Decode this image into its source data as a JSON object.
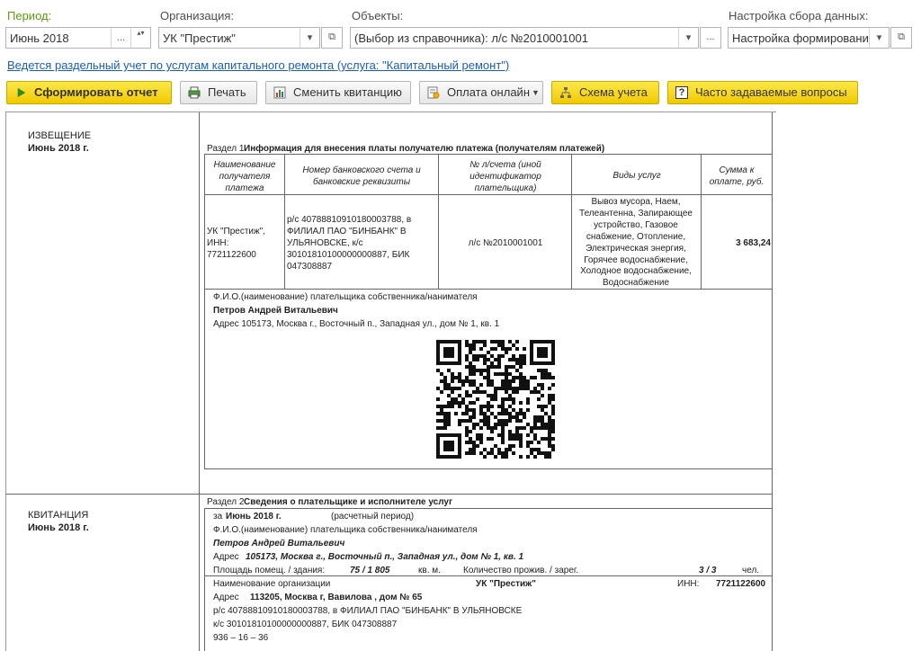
{
  "filters": {
    "period_label": "Период:",
    "period_value": "Июнь 2018",
    "org_label": "Организация:",
    "org_value": "УК \"Престиж\"",
    "objects_label": "Объекты:",
    "objects_value": "(Выбор из справочника): л/с №2010001001",
    "settings_label": "Настройка сбора данных:",
    "settings_value": "Настройка формирования",
    "ellipsis": "...",
    "dropdown": "▾",
    "open": "⧉",
    "spin": "▴▾"
  },
  "link_text": "Ведется раздельный учет по услугам капитального ремонта (услуга: \"Капитальный ремонт\")",
  "toolbar": {
    "generate": "Сформировать отчет",
    "print": "Печать",
    "change_receipt": "Сменить квитанцию",
    "pay_online": "Оплата онлайн",
    "scheme": "Схема учета",
    "faq": "Часто задаваемые вопросы"
  },
  "notice": {
    "title": "ИЗВЕЩЕНИЕ",
    "period": "Июнь 2018 г.",
    "section_no": "Раздел 1",
    "section_title": "Информация для внесения платы получателю платежа (получателям платежей)",
    "headers": {
      "recipient": "Наименование получателя платежа",
      "account": "Номер банковского счета и банковские реквизиты",
      "payer_id": "№ л/счета (иной идентификатор плательщика)",
      "services": "Виды услуг",
      "amount": "Сумма к оплате, руб."
    },
    "row": {
      "recipient": "УК \"Престиж\", ИНН: 7721122600",
      "account": "р/с 40788810910180003788, в ФИЛИАЛ ПАО \"БИНБАНК\" В УЛЬЯНОВСКЕ, к/с 30101810100000000887, БИК 047308887",
      "payer_id": "л/с №2010001001",
      "services": "Вывоз мусора, Наем, Телеантенна, Запирающее устройство, Газовое снабжение, Отопление, Электрическая энергия, Горячее водоснабжение, Холодное водоснабжение, Водоснабжение",
      "amount": "3 683,24"
    },
    "payer_label": "Ф.И.О.(наименование) плательщика собственника/нанимателя",
    "payer_name": "Петров Андрей Витальевич",
    "address": "Адрес 105173, Москва г., Восточный п., Западная ул., дом № 1, кв. 1"
  },
  "receipt": {
    "title": "КВИТАНЦИЯ",
    "period": "Июнь 2018 г.",
    "section_no": "Раздел 2",
    "section_title": "Сведения о плательщике и исполнителе услуг",
    "for_label": "за",
    "for_period": "Июнь 2018 г.",
    "period_caption": "(расчетный период)",
    "payer_label": "Ф.И.О.(наименование) плательщика собственника/нанимателя",
    "payer_name": "Петров Андрей Витальевич",
    "address_label": "Адрес",
    "address_value": "105173, Москва г., Восточный п., Западная ул., дом № 1, кв. 1",
    "area_label": "Площадь помещ. / здания:",
    "area_value": "75 / 1 805",
    "area_unit": "кв. м.",
    "residents_label": "Количество прожив. / зарег.",
    "residents_value": "3 / 3",
    "residents_unit": "чел.",
    "org_label": "Наименование организации",
    "org_name": "УК \"Престиж\"",
    "inn_label": "ИНН:",
    "inn_value": "7721122600",
    "org_address_label": "Адрес",
    "org_address_value": "113205, Москва г, Вавилова , дом № 65",
    "org_account": "р/с 40788810910180003788, в ФИЛИАЛ ПАО \"БИНБАНК\" В УЛЬЯНОВСКЕ",
    "org_bank": "к/с 30101810100000000887, БИК 047308887",
    "phone": "936 – 16 – 36"
  }
}
